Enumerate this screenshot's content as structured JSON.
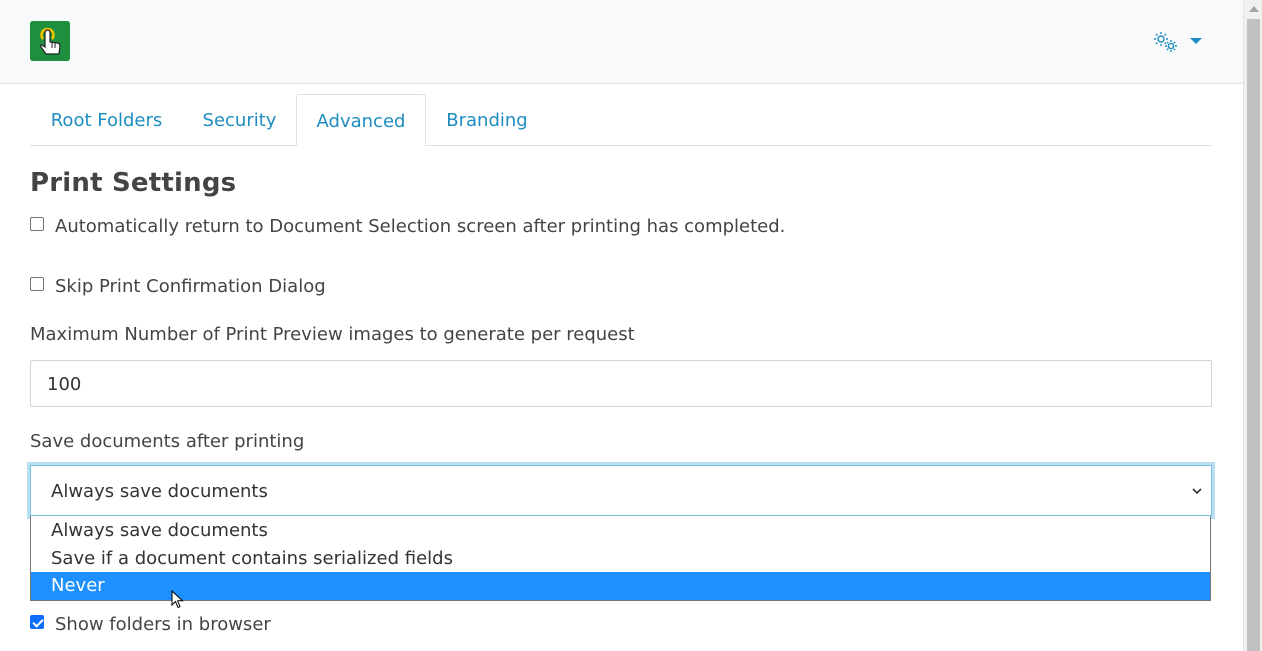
{
  "header": {
    "logo_icon": "touch-hand-icon",
    "settings_icon": "gears-icon",
    "accent_color": "#1f8dc0"
  },
  "tabs": [
    {
      "label": "Root Folders",
      "active": false
    },
    {
      "label": "Security",
      "active": false
    },
    {
      "label": "Advanced",
      "active": true
    },
    {
      "label": "Branding",
      "active": false
    }
  ],
  "section": {
    "title": "Print Settings"
  },
  "settings": {
    "auto_return": {
      "label": "Automatically return to Document Selection screen after printing has completed.",
      "checked": false
    },
    "skip_confirm": {
      "label": "Skip Print Confirmation Dialog",
      "checked": false
    },
    "max_preview": {
      "label": "Maximum Number of Print Preview images to generate per request",
      "value": "100"
    },
    "save_docs": {
      "label": "Save documents after printing",
      "selected": "Always save documents",
      "options": [
        "Always save documents",
        "Save if a document contains serialized fields",
        "Never"
      ],
      "highlighted_option": "Never"
    },
    "show_folders": {
      "label": "Show folders in browser",
      "checked": true
    }
  }
}
